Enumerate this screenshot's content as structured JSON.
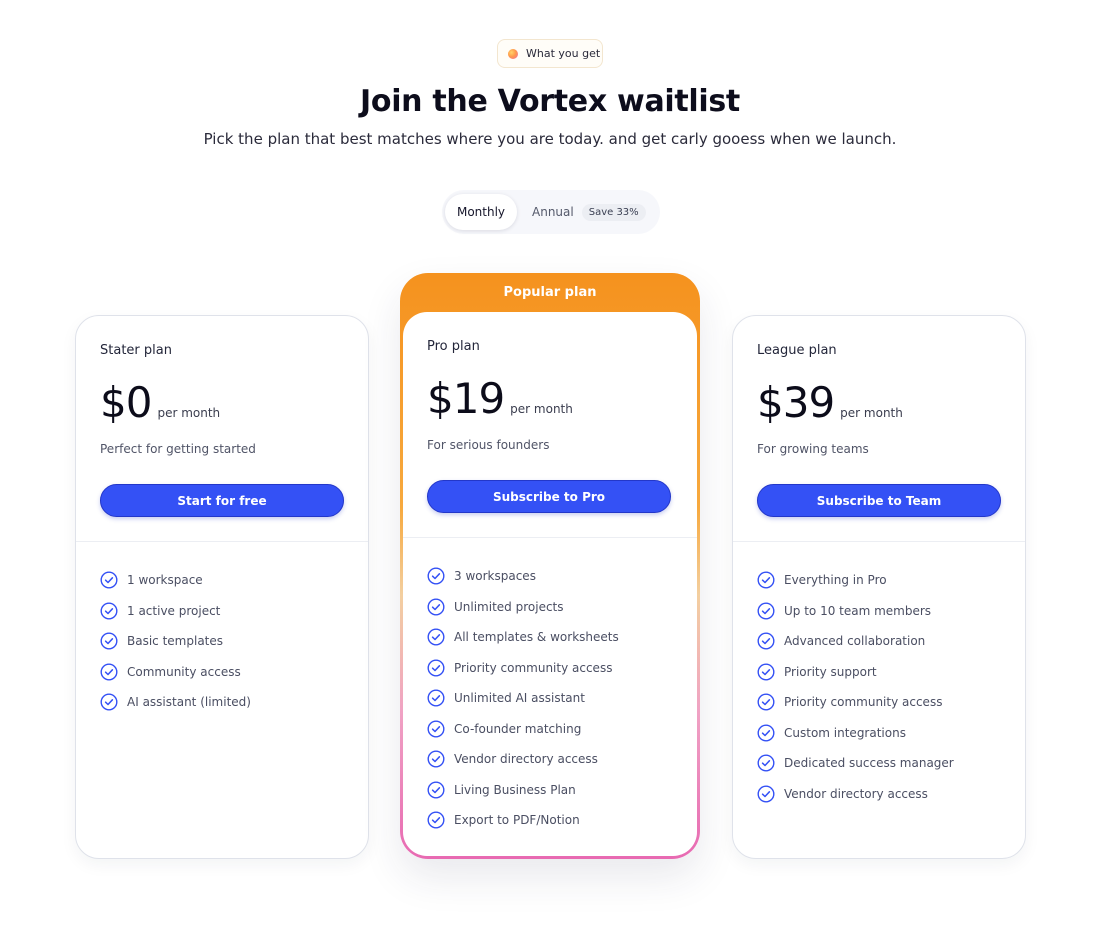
{
  "badge": {
    "label": "What you get"
  },
  "hero": {
    "title": "Join the Vortex waitlist",
    "subtitle": "Pick the plan that best matches where you are today. and get carly gooess when we launch."
  },
  "billing": {
    "monthly": "Monthly",
    "annual": "Annual",
    "save": "Save 33%",
    "selected": "Monthly"
  },
  "colors": {
    "accent": "#3451f5",
    "popular_gradient_top": "#f5921e",
    "popular_gradient_bottom": "#e86ab2",
    "check": "#3451f5"
  },
  "plans": [
    {
      "name": "Stater plan",
      "price": "$0",
      "period": "per month",
      "description": "Perfect for getting started",
      "cta": "Start for free",
      "features": [
        "1 workspace",
        "1 active project",
        "Basic templates",
        "Community access",
        "AI assistant (limited)"
      ]
    },
    {
      "badge": "Popular plan",
      "name": "Pro plan",
      "price": "$19",
      "period": "per month",
      "description": "For serious founders",
      "cta": "Subscribe to Pro",
      "features": [
        "3 workspaces",
        "Unlimited projects",
        "All templates & worksheets",
        "Priority community access",
        "Unlimited AI assistant",
        "Co-founder matching",
        "Vendor directory access",
        "Living Business Plan",
        "Export to PDF/Notion"
      ]
    },
    {
      "name": "League plan",
      "price": "$39",
      "period": "per month",
      "description": "For growing teams",
      "cta": "Subscribe to Team",
      "features": [
        "Everything in Pro",
        "Up to 10 team members",
        "Advanced collaboration",
        "Priority support",
        "Priority community access",
        "Custom integrations",
        "Dedicated success manager",
        "Vendor directory access"
      ]
    }
  ]
}
